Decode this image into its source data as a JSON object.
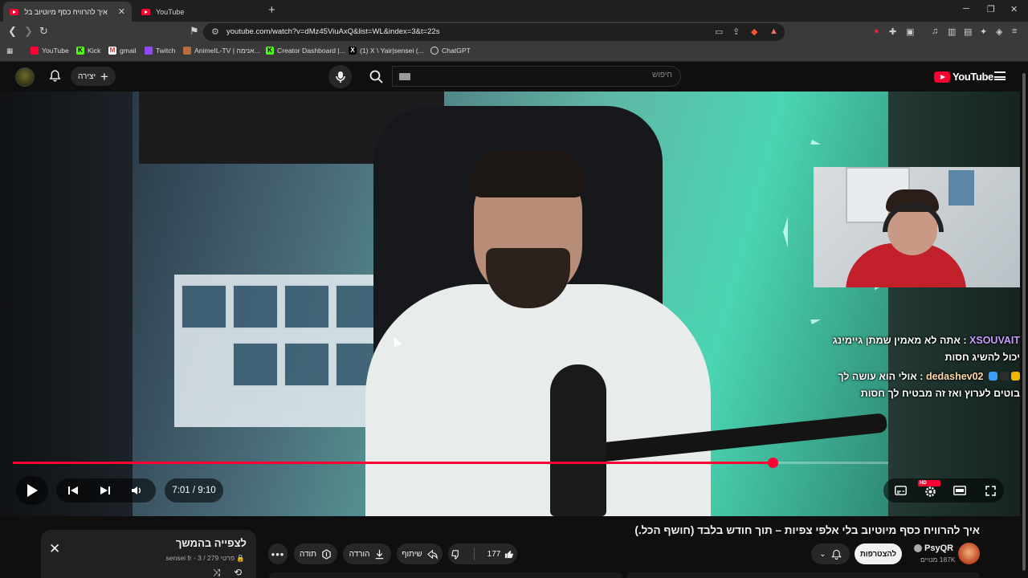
{
  "browser": {
    "tabs": [
      {
        "label": "איך להרוויח כסף מיוטיוב בלי אלפי",
        "active": true
      },
      {
        "label": "YouTube",
        "active": false
      }
    ],
    "url": "youtube.com/watch?v=dMz45ViuAxQ&list=WL&index=3&t=22s",
    "bookmarks": [
      "YouTube",
      "Kick",
      "gmail",
      "Twitch",
      "AnimeIL-TV | אנימה...",
      "Creator Dashboard |...",
      "(1) X \\ Yair|sensei (...",
      "ChatGPT"
    ]
  },
  "header": {
    "create_label": "יצירה",
    "search_placeholder": "חיפוש",
    "logo_text": "YouTube"
  },
  "player": {
    "current_time": "7:01",
    "duration": "9:10",
    "time_label": "7:01 / 9:10",
    "progress_fraction": 0.868,
    "hd_label": "HD",
    "accent_color": "#ff0033"
  },
  "chat": [
    {
      "user": "XSOUVAIT",
      "text": "אתה לא מאמין שמתן גיימינג יכול להשיג חסות"
    },
    {
      "user": "dedashev02",
      "text": "אולי הוא עושה לך בוטים לערוץ ואז זה מבטיח לך חסות"
    }
  ],
  "playlist": {
    "title": "לצפייה בהמשך",
    "privacy": "פרטי",
    "owner": "sensei fr",
    "position": "3 / 279"
  },
  "video": {
    "title": "איך להרוויח כסף מיוטיוב בלי אלפי צפיות – תוך חודש בלבד (חושף הכל.)",
    "likes": "177",
    "share_label": "שיתוף",
    "download_label": "הורדה",
    "thanks_label": "תודה",
    "subscribe_label": "להצטרפות",
    "channel": "PsyQR",
    "subscribers": "187K מנויים"
  }
}
